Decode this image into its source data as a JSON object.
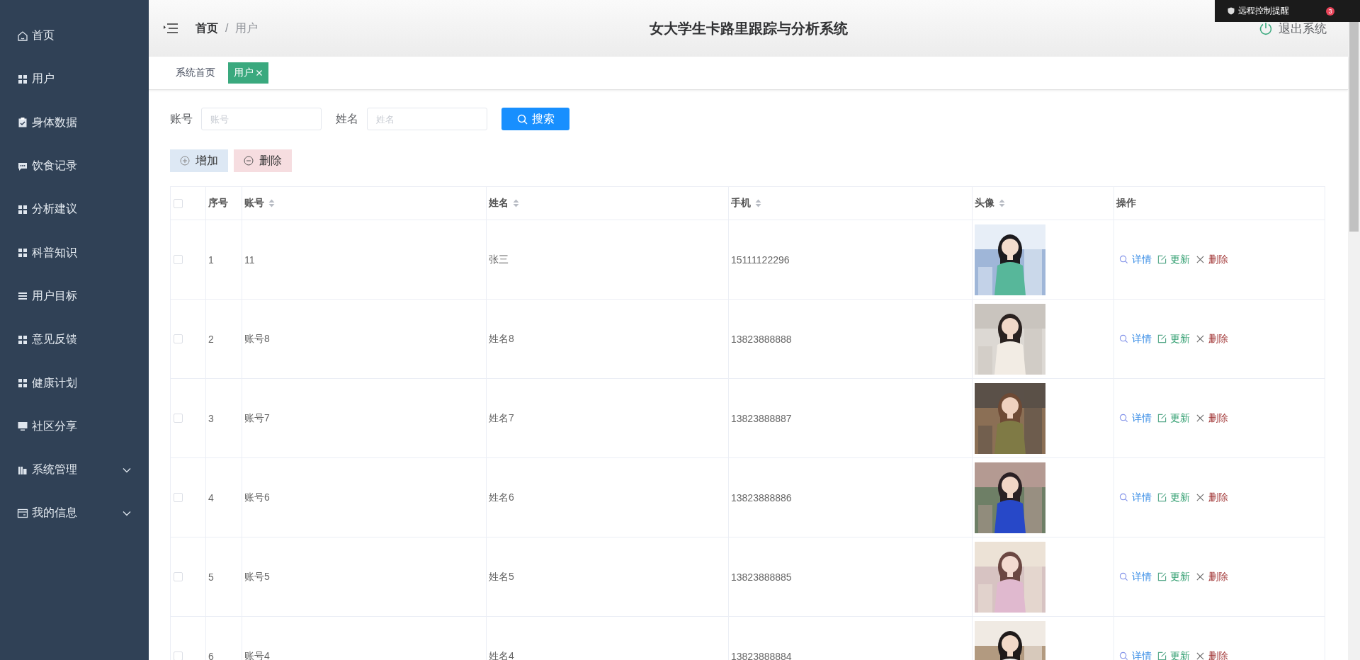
{
  "sidebar": {
    "items": [
      {
        "label": "首页",
        "kind": "link"
      },
      {
        "label": "用户",
        "kind": "link"
      },
      {
        "label": "身体数据",
        "kind": "link"
      },
      {
        "label": "饮食记录",
        "kind": "link"
      },
      {
        "label": "分析建议",
        "kind": "link"
      },
      {
        "label": "科普知识",
        "kind": "link"
      },
      {
        "label": "用户目标",
        "kind": "link"
      },
      {
        "label": "意见反馈",
        "kind": "link"
      },
      {
        "label": "健康计划",
        "kind": "link"
      },
      {
        "label": "社区分享",
        "kind": "link"
      },
      {
        "label": "系统管理",
        "kind": "submenu",
        "expanded": false
      },
      {
        "label": "我的信息",
        "kind": "submenu",
        "expanded": false
      }
    ]
  },
  "header": {
    "breadcrumb": [
      "首页",
      "用户"
    ],
    "separator": "/",
    "title": "女大学生卡路里跟踪与分析系统",
    "logout": "退出系统"
  },
  "notice": {
    "text": "远程控制提醒",
    "count": "3"
  },
  "tags": [
    {
      "label": "系统首页",
      "selected": false,
      "closable": false
    },
    {
      "label": "用户",
      "selected": true,
      "closable": true
    }
  ],
  "search": {
    "fields": [
      {
        "label": "账号",
        "placeholder": "账号"
      },
      {
        "label": "姓名",
        "placeholder": "姓名"
      }
    ],
    "button": "搜索"
  },
  "actions": [
    {
      "label": "增加",
      "kind": "add"
    },
    {
      "label": "删除",
      "kind": "delete"
    }
  ],
  "table": {
    "all_checked": false,
    "columns": [
      {
        "label": "序号",
        "sortable": false
      },
      {
        "label": "账号",
        "sortable": true
      },
      {
        "label": "姓名",
        "sortable": true
      },
      {
        "label": "手机",
        "sortable": true
      },
      {
        "label": "头像",
        "sortable": true
      },
      {
        "label": "操作",
        "sortable": false
      }
    ],
    "rows": [
      {
        "checked": false,
        "cells": [
          "1",
          "11",
          "张三",
          "15111122296"
        ],
        "avatar": {
          "kind": "picture"
        },
        "ops": [
          {
            "label": "详情",
            "kind": "detail"
          },
          {
            "label": "更新",
            "kind": "update"
          },
          {
            "label": "删除",
            "kind": "delete"
          }
        ]
      },
      {
        "checked": false,
        "cells": [
          "2",
          "账号8",
          "姓名8",
          "13823888888"
        ],
        "avatar": {
          "kind": "picture"
        },
        "ops": [
          {
            "label": "详情",
            "kind": "detail"
          },
          {
            "label": "更新",
            "kind": "update"
          },
          {
            "label": "删除",
            "kind": "delete"
          }
        ]
      },
      {
        "checked": false,
        "cells": [
          "3",
          "账号7",
          "姓名7",
          "13823888887"
        ],
        "avatar": {
          "kind": "picture"
        },
        "ops": [
          {
            "label": "详情",
            "kind": "detail"
          },
          {
            "label": "更新",
            "kind": "update"
          },
          {
            "label": "删除",
            "kind": "delete"
          }
        ]
      },
      {
        "checked": false,
        "cells": [
          "4",
          "账号6",
          "姓名6",
          "13823888886"
        ],
        "avatar": {
          "kind": "picture"
        },
        "ops": [
          {
            "label": "详情",
            "kind": "detail"
          },
          {
            "label": "更新",
            "kind": "update"
          },
          {
            "label": "删除",
            "kind": "delete"
          }
        ]
      },
      {
        "checked": false,
        "cells": [
          "5",
          "账号5",
          "姓名5",
          "13823888885"
        ],
        "avatar": {
          "kind": "picture"
        },
        "ops": [
          {
            "label": "详情",
            "kind": "detail"
          },
          {
            "label": "更新",
            "kind": "update"
          },
          {
            "label": "删除",
            "kind": "delete"
          }
        ]
      },
      {
        "checked": false,
        "cells": [
          "6",
          "账号4",
          "姓名4",
          "13823888884"
        ],
        "avatar": {
          "kind": "picture"
        },
        "ops": [
          {
            "label": "详情",
            "kind": "detail"
          },
          {
            "label": "更新",
            "kind": "update"
          },
          {
            "label": "删除",
            "kind": "delete"
          }
        ]
      }
    ]
  }
}
